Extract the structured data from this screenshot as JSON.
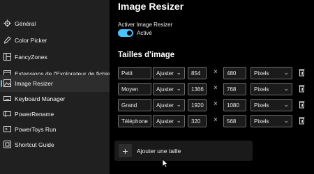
{
  "sidebar": {
    "items": [
      {
        "label": "Général",
        "icon": "gear-icon",
        "selected": false
      },
      {
        "label": "Color Picker",
        "icon": "color-picker-icon",
        "selected": false
      },
      {
        "label": "FancyZones",
        "icon": "fancyzones-icon",
        "selected": false
      },
      {
        "label": "Extensions de l'Explorateur de fichiers",
        "icon": "file-explorer-icon",
        "selected": false
      },
      {
        "label": "Image Resizer",
        "icon": "image-resizer-icon",
        "selected": true
      },
      {
        "label": "Keyboard Manager",
        "icon": "keyboard-icon",
        "selected": false
      },
      {
        "label": "PowerRename",
        "icon": "rename-icon",
        "selected": false
      },
      {
        "label": "PowerToys Run",
        "icon": "run-icon",
        "selected": false
      },
      {
        "label": "Shortcut Guide",
        "icon": "shortcut-icon",
        "selected": false
      }
    ]
  },
  "main": {
    "title": "Image Resizer",
    "enable_label": "Activer Image Resizer",
    "toggle_state": "Activé",
    "toggle_on": true,
    "section_title": "Tailles d'image",
    "sizes": [
      {
        "name": "Petit",
        "fit": "Ajuster",
        "width": "854",
        "height": "480",
        "unit": "Pixels"
      },
      {
        "name": "Moyen",
        "fit": "Ajuster",
        "width": "1366",
        "height": "768",
        "unit": "Pixels"
      },
      {
        "name": "Grand",
        "fit": "Ajuster",
        "width": "1920",
        "height": "1080",
        "unit": "Pixels"
      },
      {
        "name": "Téléphone",
        "fit": "Ajuster",
        "width": "320",
        "height": "568",
        "unit": "Pixels"
      }
    ],
    "times_symbol": "×",
    "add_label": "Ajouter une taille",
    "add_symbol": "+"
  },
  "colors": {
    "accent": "#4cc2ff",
    "sidebar_bg": "#202020",
    "main_bg": "#000000"
  }
}
